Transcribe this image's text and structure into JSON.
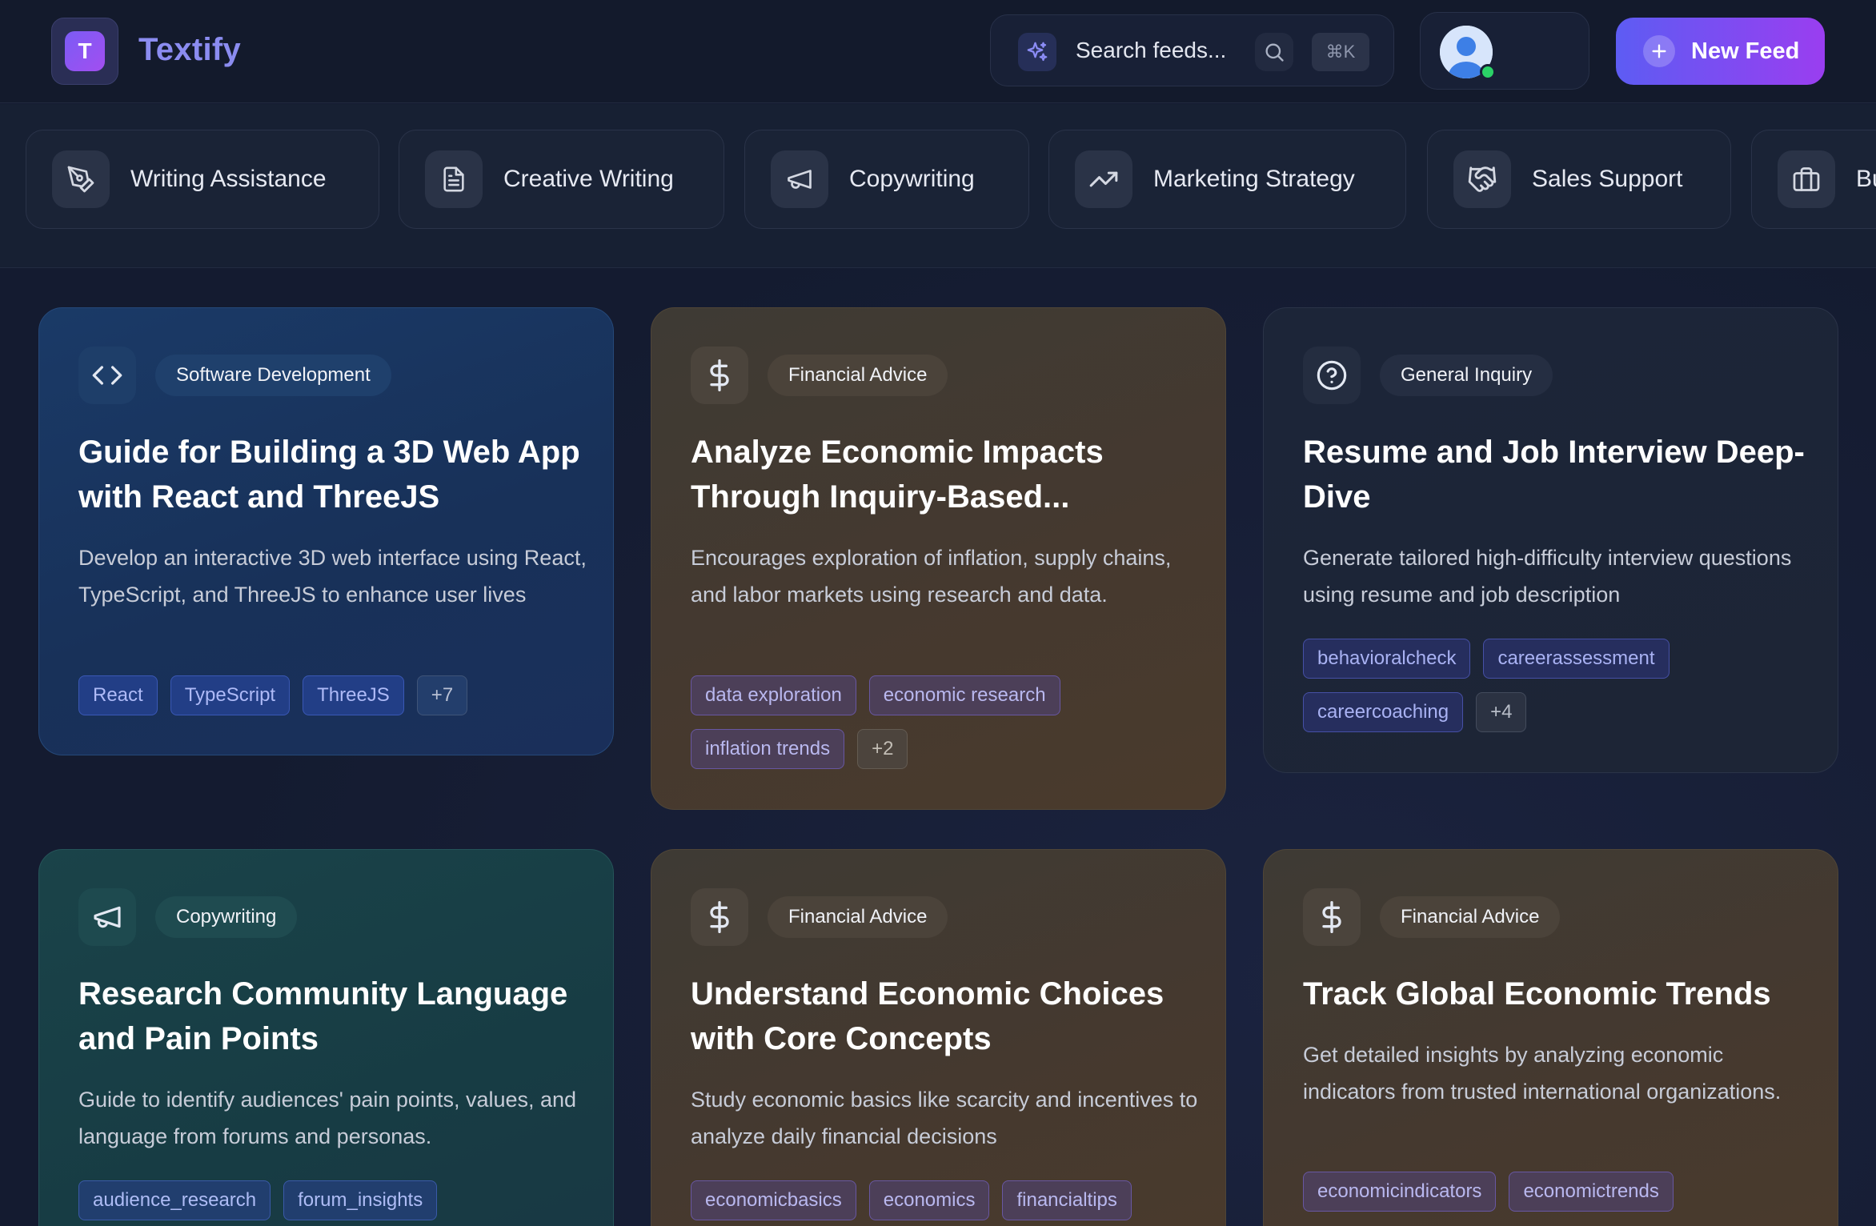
{
  "app": {
    "logo_letter": "T",
    "name": "Textify"
  },
  "search": {
    "placeholder": "Search feeds...",
    "shortcut": "⌘K"
  },
  "user": {
    "status": "online"
  },
  "new_feed": {
    "label": "New Feed"
  },
  "categories": [
    {
      "label": "Writing Assistance",
      "icon": "pen-tool-icon"
    },
    {
      "label": "Creative Writing",
      "icon": "document-icon"
    },
    {
      "label": "Copywriting",
      "icon": "megaphone-icon"
    },
    {
      "label": "Marketing Strategy",
      "icon": "trending-up-icon"
    },
    {
      "label": "Sales Support",
      "icon": "handshake-icon"
    },
    {
      "label": "Bu",
      "icon": "briefcase-icon"
    }
  ],
  "cards": [
    {
      "category": "Software Development",
      "icon": "code-icon",
      "title": "Guide for Building a 3D Web App with React and ThreeJS",
      "description": "Develop an interactive 3D web interface using React, TypeScript, and ThreeJS to enhance user lives",
      "tags": [
        "React",
        "TypeScript",
        "ThreeJS"
      ],
      "more": "+7",
      "accent": "#1a3a67"
    },
    {
      "category": "Financial Advice",
      "icon": "dollar-icon",
      "title": "Analyze Economic Impacts Through Inquiry-Based...",
      "description": "Encourages exploration of inflation, supply chains, and labor markets using research and data.",
      "tags": [
        "data exploration",
        "economic research",
        "inflation trends"
      ],
      "more": "+2",
      "accent": "#45392f"
    },
    {
      "category": "General Inquiry",
      "icon": "help-circle-icon",
      "title": "Resume and Job Interview Deep-Dive",
      "description": "Generate tailored high-difficulty interview questions using resume and job description",
      "tags": [
        "behavioralcheck",
        "careerassessment",
        "careercoaching"
      ],
      "more": "+4",
      "accent": "#1c2538"
    },
    {
      "category": "Copywriting",
      "icon": "megaphone-icon",
      "title": "Research Community Language and Pain Points",
      "description": "Guide to identify audiences' pain points, values, and language from forums and personas.",
      "tags": [
        "audience_research",
        "forum_insights"
      ],
      "more": "",
      "accent": "#1a4349"
    },
    {
      "category": "Financial Advice",
      "icon": "dollar-icon",
      "title": "Understand Economic Choices with Core Concepts",
      "description": "Study economic basics like scarcity and incentives to analyze daily financial decisions",
      "tags": [
        "economicbasics",
        "economics",
        "financialtips"
      ],
      "more": "",
      "accent": "#45392f"
    },
    {
      "category": "Financial Advice",
      "icon": "dollar-icon",
      "title": "Track Global Economic Trends",
      "description": "Get detailed insights by analyzing economic indicators from trusted international organizations.",
      "tags": [
        "economicindicators",
        "economictrends"
      ],
      "more": "",
      "accent": "#45392f"
    }
  ]
}
